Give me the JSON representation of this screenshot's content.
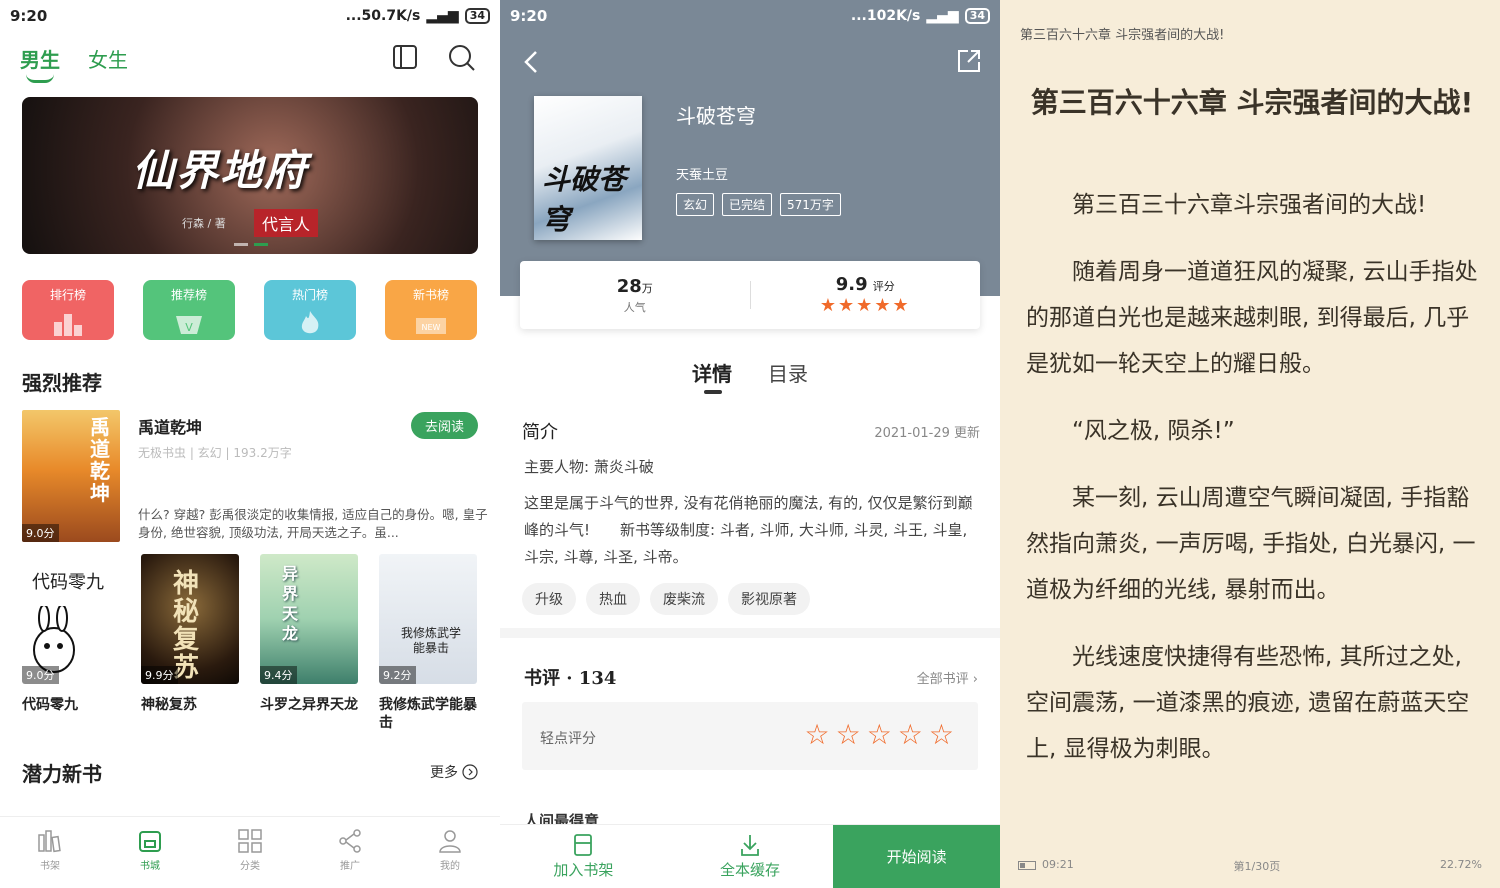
{
  "left": {
    "status": {
      "time": "9:20",
      "right": "...50.7K/s",
      "battery": "34"
    },
    "tabs": {
      "male": "男生",
      "female": "女生"
    },
    "banner": {
      "title": "仙界地府",
      "subtitle": "代言人",
      "author": "行森 / 著"
    },
    "ranks": [
      {
        "label": "排行榜"
      },
      {
        "label": "推荐榜"
      },
      {
        "label": "热门榜"
      },
      {
        "label": "新书榜",
        "badge": "NEW"
      }
    ],
    "section_recommend": "强烈推荐",
    "featured": {
      "title": "禹道乾坤",
      "meta": "无极书虫 | 玄幻 | 193.2万字",
      "desc": "什么? 穿越? 彭禹很淡定的收集情报, 适应自己的身份。嗯, 皇子身份, 绝世容貌, 顶级功法, 开局天选之子。虽...",
      "score": "9.0分",
      "cover_text": "禹道乾坤",
      "button": "去阅读"
    },
    "grid": [
      {
        "name": "代码零九",
        "score": "9.0分",
        "cover_text": "代码零九"
      },
      {
        "name": "神秘复苏",
        "score": "9.9分",
        "cover_text": "神秘复苏"
      },
      {
        "name": "斗罗之异界天龙",
        "score": "9.4分",
        "cover_text": "异界天龙"
      },
      {
        "name": "我修炼武学能暴击",
        "score": "9.2分",
        "cover_text": "我修炼武学能暴击"
      }
    ],
    "section_new": "潜力新书",
    "more": "更多",
    "nav": [
      {
        "label": "书架",
        "icon": "bookshelf-icon"
      },
      {
        "label": "书城",
        "icon": "store-icon"
      },
      {
        "label": "分类",
        "icon": "category-icon"
      },
      {
        "label": "推广",
        "icon": "share-icon"
      },
      {
        "label": "我的",
        "icon": "profile-icon"
      }
    ]
  },
  "middle": {
    "status": {
      "time": "9:20",
      "right": "...102K/s",
      "battery": "34"
    },
    "book": {
      "title": "斗破苍穹",
      "author": "天蚕土豆",
      "tags": [
        "玄幻",
        "已完结",
        "571万字"
      ],
      "cover_text": "斗破苍穹"
    },
    "stats": {
      "popularity": "28",
      "popularity_unit": "万",
      "popularity_label": "人气",
      "rating": "9.9",
      "rating_label": "评分",
      "stars": "★★★★★"
    },
    "tabs": {
      "detail": "详情",
      "catalog": "目录"
    },
    "intro": {
      "heading": "简介",
      "date": "2021-01-29 更新",
      "main_chars": "主要人物: 萧炎斗破",
      "desc": "这里是属于斗气的世界, 没有花俏艳丽的魔法, 有的, 仅仅是繁衍到巅峰的斗气!　　新书等级制度: 斗者, 斗师, 大斗师, 斗灵, 斗王, 斗皇, 斗宗, 斗尊, 斗圣, 斗帝。"
    },
    "topic_tags": [
      "升级",
      "热血",
      "废柴流",
      "影视原著"
    ],
    "reviews": {
      "heading": "书评 · 134",
      "all": "全部书评",
      "rate_label": "轻点评分",
      "empty_stars": "☆☆☆☆☆",
      "peek": "人间最得意"
    },
    "bottom": {
      "add": "加入书架",
      "cache": "全本缓存",
      "start": "开始阅读"
    }
  },
  "right": {
    "header": "第三百六十六章 斗宗强者间的大战!",
    "title": "第三百六十六章 斗宗强者间的大战!",
    "paragraphs": [
      "第三百三十六章斗宗强者间的大战!",
      "随着周身一道道狂风的凝聚, 云山手指处的那道白光也是越来越刺眼, 到得最后, 几乎是犹如一轮天空上的耀日般。",
      "“风之极, 陨杀!”",
      "某一刻, 云山周遭空气瞬间凝固, 手指豁然指向萧炎, 一声厉喝, 手指处, 白光暴闪, 一道极为纤细的光线, 暴射而出。",
      "光线速度快捷得有些恐怖, 其所过之处, 空间震荡, 一道漆黑的痕迹, 遗留在蔚蓝天空上, 显得极为刺眼。"
    ],
    "footer": {
      "time": "09:21",
      "page": "第1/30页",
      "percent": "22.72%"
    }
  }
}
